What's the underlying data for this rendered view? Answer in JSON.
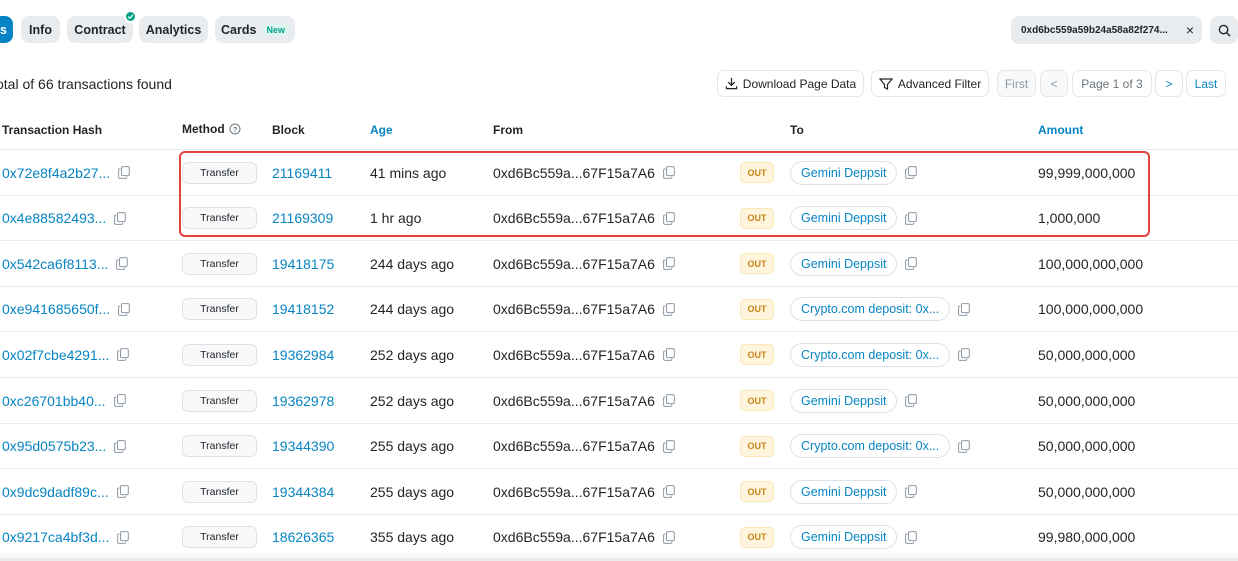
{
  "tabs": [
    {
      "label": "s",
      "active": true
    },
    {
      "label": "Info"
    },
    {
      "label": "Contract",
      "verified": true
    },
    {
      "label": "Analytics"
    },
    {
      "label": "Cards",
      "badge": "New"
    }
  ],
  "filter": {
    "address": "0xd6bc559a59b24a58a82f274...",
    "close": "×"
  },
  "summary": "otal of 66 transactions found",
  "toolbar": {
    "download": "Download Page Data",
    "advanced_filter": "Advanced Filter"
  },
  "pager": {
    "first": "First",
    "prev": "<",
    "page": "Page 1 of 3",
    "next": ">",
    "last": "Last"
  },
  "columns": {
    "hash": "Transaction Hash",
    "method": "Method",
    "block": "Block",
    "age": "Age",
    "from": "From",
    "to": "To",
    "amount": "Amount"
  },
  "rows": [
    {
      "hash": "0x72e8f4a2b27...",
      "method": "Transfer",
      "block": "21169411",
      "age": "41 mins ago",
      "from": "0xd6Bc559a...67F15a7A6",
      "dir": "OUT",
      "to": "Gemini Deppsit",
      "amount": "99,999,000,000"
    },
    {
      "hash": "0x4e88582493...",
      "method": "Transfer",
      "block": "21169309",
      "age": "1 hr ago",
      "from": "0xd6Bc559a...67F15a7A6",
      "dir": "OUT",
      "to": "Gemini Deppsit",
      "amount": "1,000,000"
    },
    {
      "hash": "0x542ca6f8113...",
      "method": "Transfer",
      "block": "19418175",
      "age": "244 days ago",
      "from": "0xd6Bc559a...67F15a7A6",
      "dir": "OUT",
      "to": "Gemini Deppsit",
      "amount": "100,000,000,000"
    },
    {
      "hash": "0xe941685650f...",
      "method": "Transfer",
      "block": "19418152",
      "age": "244 days ago",
      "from": "0xd6Bc559a...67F15a7A6",
      "dir": "OUT",
      "to": "Crypto.com deposit: 0x...",
      "amount": "100,000,000,000"
    },
    {
      "hash": "0x02f7cbe4291...",
      "method": "Transfer",
      "block": "19362984",
      "age": "252 days ago",
      "from": "0xd6Bc559a...67F15a7A6",
      "dir": "OUT",
      "to": "Crypto.com deposit: 0x...",
      "amount": "50,000,000,000"
    },
    {
      "hash": "0xc26701bb40...",
      "method": "Transfer",
      "block": "19362978",
      "age": "252 days ago",
      "from": "0xd6Bc559a...67F15a7A6",
      "dir": "OUT",
      "to": "Gemini Deppsit",
      "amount": "50,000,000,000"
    },
    {
      "hash": "0x95d0575b23...",
      "method": "Transfer",
      "block": "19344390",
      "age": "255 days ago",
      "from": "0xd6Bc559a...67F15a7A6",
      "dir": "OUT",
      "to": "Crypto.com deposit: 0x...",
      "amount": "50,000,000,000"
    },
    {
      "hash": "0x9dc9dadf89c...",
      "method": "Transfer",
      "block": "19344384",
      "age": "255 days ago",
      "from": "0xd6Bc559a...67F15a7A6",
      "dir": "OUT",
      "to": "Gemini Deppsit",
      "amount": "50,000,000,000"
    },
    {
      "hash": "0x9217ca4bf3d...",
      "method": "Transfer",
      "block": "18626365",
      "age": "355 days ago",
      "from": "0xd6Bc559a...67F15a7A6",
      "dir": "OUT",
      "to": "Gemini Deppsit",
      "amount": "99,980,000,000"
    }
  ],
  "colors": {
    "link": "#0784c3",
    "highlight": "#e0433b",
    "out_bg": "#fff4dc",
    "out_text": "#c9841a"
  },
  "icons": [
    "copy-icon",
    "download-icon",
    "filter-icon",
    "search-icon",
    "info-circle-icon",
    "check-icon",
    "close-icon"
  ]
}
